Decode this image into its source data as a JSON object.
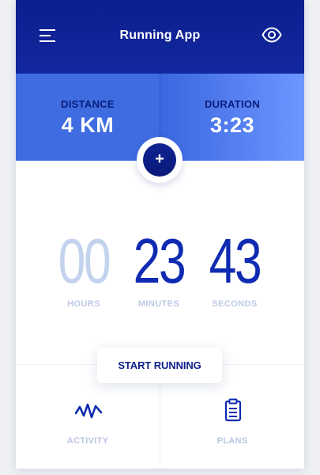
{
  "header": {
    "title": "Running App",
    "menu_icon": "menu-icon",
    "view_icon": "eye-icon"
  },
  "stats": {
    "distance": {
      "label": "DISTANCE",
      "value": "4 KM"
    },
    "duration": {
      "label": "DURATION",
      "value": "3:23"
    }
  },
  "add_button": {
    "label": "+",
    "icon": "plus-icon"
  },
  "timer": {
    "hours": {
      "value": "00",
      "label": "HOURS"
    },
    "minutes": {
      "value": "23",
      "label": "MINUTES"
    },
    "seconds": {
      "value": "43",
      "label": "SECONDS"
    }
  },
  "start_button": {
    "label": "START RUNNING"
  },
  "tabs": [
    {
      "label": "ACTIVITY",
      "icon": "activity-icon"
    },
    {
      "label": "PLANS",
      "icon": "clipboard-icon"
    }
  ],
  "colors": {
    "header": "#0c1e8e",
    "accent": "#3f6de1",
    "active_digits": "#0f2bb2",
    "muted_digits": "#c3d3ed"
  }
}
